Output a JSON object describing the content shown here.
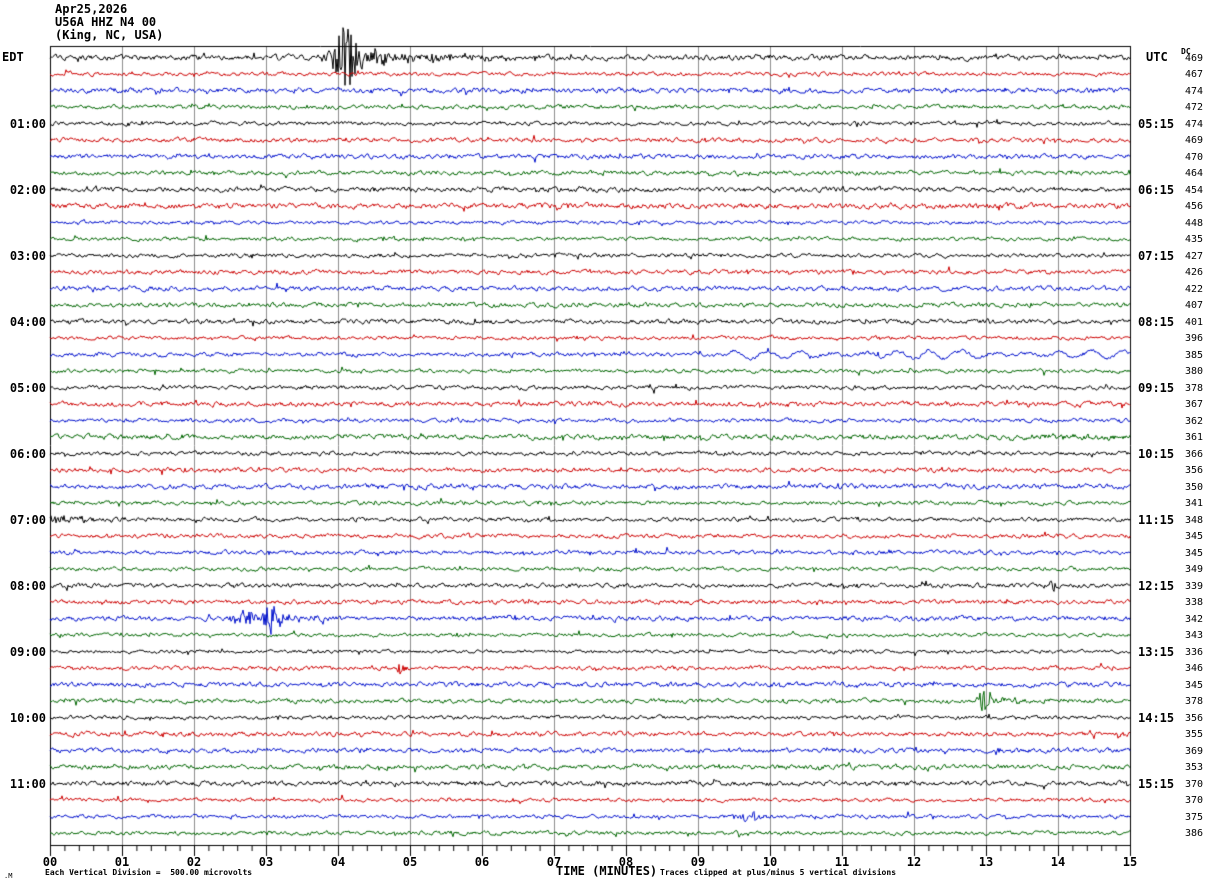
{
  "title": {
    "date": "Apr25,2026",
    "station": "U56A HHZ N4 00",
    "location": "(King, NC, USA)"
  },
  "axes": {
    "left_header": "EDT",
    "right_header": "UTC",
    "dc_header": "DC",
    "x_title": "TIME (MINUTES)",
    "x_ticks": [
      "00",
      "01",
      "02",
      "03",
      "04",
      "05",
      "06",
      "07",
      "08",
      "09",
      "10",
      "11",
      "12",
      "13",
      "14",
      "15"
    ],
    "footnote_left": "Each Vertical Division =  500.00 microvolts",
    "footnote_right": "Traces clipped at plus/minus 5 vertical divisions",
    "corner_mark": ".M"
  },
  "chart_data": {
    "type": "line",
    "kind": "seismogram-helicorder",
    "minutes_per_line": 15,
    "x_range": [
      0,
      15
    ],
    "vertical_division_microvolts": 500.0,
    "clip_divisions": 5,
    "row_color_cycle": [
      "black",
      "red",
      "blue",
      "green"
    ],
    "colors": {
      "black": "#000000",
      "red": "#cc0000",
      "blue": "#0011cc",
      "green": "#006600"
    },
    "grid_color": "#8c8c8c",
    "rows": [
      {
        "i": 0,
        "dc": 469
      },
      {
        "i": 1,
        "dc": 467
      },
      {
        "i": 2,
        "dc": 474
      },
      {
        "i": 3,
        "dc": 472
      },
      {
        "i": 4,
        "dc": 474,
        "edt": "01:00",
        "utc": "05:15"
      },
      {
        "i": 5,
        "dc": 469
      },
      {
        "i": 6,
        "dc": 470
      },
      {
        "i": 7,
        "dc": 464
      },
      {
        "i": 8,
        "dc": 454,
        "edt": "02:00",
        "utc": "06:15"
      },
      {
        "i": 9,
        "dc": 456
      },
      {
        "i": 10,
        "dc": 448
      },
      {
        "i": 11,
        "dc": 435
      },
      {
        "i": 12,
        "dc": 427,
        "edt": "03:00",
        "utc": "07:15"
      },
      {
        "i": 13,
        "dc": 426
      },
      {
        "i": 14,
        "dc": 422
      },
      {
        "i": 15,
        "dc": 407
      },
      {
        "i": 16,
        "dc": 401,
        "edt": "04:00",
        "utc": "08:15"
      },
      {
        "i": 17,
        "dc": 396
      },
      {
        "i": 18,
        "dc": 385
      },
      {
        "i": 19,
        "dc": 380
      },
      {
        "i": 20,
        "dc": 378,
        "edt": "05:00",
        "utc": "09:15"
      },
      {
        "i": 21,
        "dc": 367
      },
      {
        "i": 22,
        "dc": 362
      },
      {
        "i": 23,
        "dc": 361
      },
      {
        "i": 24,
        "dc": 366,
        "edt": "06:00",
        "utc": "10:15"
      },
      {
        "i": 25,
        "dc": 356
      },
      {
        "i": 26,
        "dc": 350
      },
      {
        "i": 27,
        "dc": 341
      },
      {
        "i": 28,
        "dc": 348,
        "edt": "07:00",
        "utc": "11:15"
      },
      {
        "i": 29,
        "dc": 345
      },
      {
        "i": 30,
        "dc": 345
      },
      {
        "i": 31,
        "dc": 349
      },
      {
        "i": 32,
        "dc": 339,
        "edt": "08:00",
        "utc": "12:15"
      },
      {
        "i": 33,
        "dc": 338
      },
      {
        "i": 34,
        "dc": 342
      },
      {
        "i": 35,
        "dc": 343
      },
      {
        "i": 36,
        "dc": 336,
        "edt": "09:00",
        "utc": "13:15"
      },
      {
        "i": 37,
        "dc": 346
      },
      {
        "i": 38,
        "dc": 345
      },
      {
        "i": 39,
        "dc": 378
      },
      {
        "i": 40,
        "dc": 356,
        "edt": "10:00",
        "utc": "14:15"
      },
      {
        "i": 41,
        "dc": 355
      },
      {
        "i": 42,
        "dc": 369
      },
      {
        "i": 43,
        "dc": 353
      },
      {
        "i": 44,
        "dc": 370,
        "edt": "11:00",
        "utc": "15:15"
      },
      {
        "i": 45,
        "dc": 370
      },
      {
        "i": 46,
        "dc": 375
      },
      {
        "i": 47,
        "dc": 386
      }
    ],
    "events": [
      {
        "row": 0,
        "type": "burst",
        "center": 4.12,
        "duration": 0.5,
        "amplitude": 28,
        "note": "large clipped event 00:04 EDT"
      },
      {
        "row": 0,
        "type": "burst",
        "center": 4.55,
        "duration": 0.3,
        "amplitude": 9
      },
      {
        "row": 0,
        "type": "burst",
        "center": 5.0,
        "duration": 0.15,
        "amplitude": 6
      },
      {
        "row": 0,
        "type": "burst",
        "center": 5.35,
        "duration": 0.12,
        "amplitude": 5
      },
      {
        "row": 0,
        "type": "coda",
        "start": 4.4,
        "end": 6.6,
        "amplitude": 3
      },
      {
        "row": 18,
        "type": "lowfreq",
        "start": 9.4,
        "end": 15,
        "amplitude": 4.5,
        "period": 0.45,
        "note": "long-period swell 04:40 EDT"
      },
      {
        "row": 23,
        "type": "coda",
        "start": 13.3,
        "end": 15,
        "amplitude": 2.2
      },
      {
        "row": 28,
        "type": "coda",
        "start": 0,
        "end": 0.9,
        "amplitude": 3
      },
      {
        "row": 32,
        "type": "burst",
        "center": 13.93,
        "duration": 0.25,
        "amplitude": 5
      },
      {
        "row": 34,
        "type": "burst",
        "center": 2.72,
        "duration": 0.4,
        "amplitude": 8,
        "note": "local event 08:32 EDT"
      },
      {
        "row": 34,
        "type": "burst",
        "center": 3.08,
        "duration": 0.3,
        "amplitude": 15
      },
      {
        "row": 34,
        "type": "coda",
        "start": 3.2,
        "end": 4.3,
        "amplitude": 2.5
      },
      {
        "row": 37,
        "type": "burst",
        "center": 4.85,
        "duration": 0.2,
        "amplitude": 4
      },
      {
        "row": 39,
        "type": "burst",
        "center": 12.98,
        "duration": 0.2,
        "amplitude": 13,
        "note": "spike 09:58 EDT"
      },
      {
        "row": 39,
        "type": "coda",
        "start": 13.0,
        "end": 14.2,
        "amplitude": 2
      },
      {
        "row": 46,
        "type": "burst",
        "center": 9.7,
        "duration": 0.5,
        "amplitude": 5
      }
    ]
  }
}
